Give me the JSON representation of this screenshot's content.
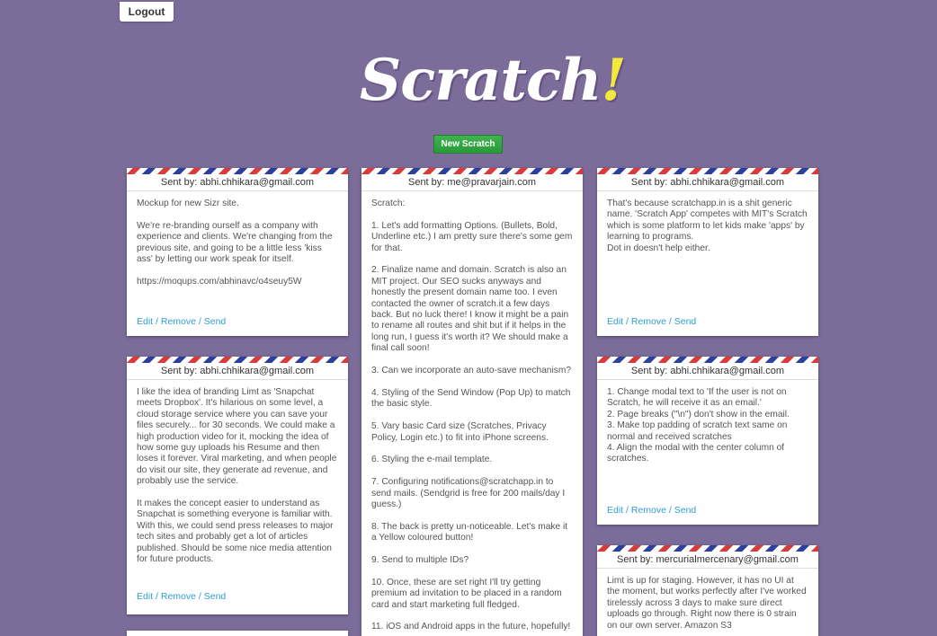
{
  "header": {
    "logout_label": "Logout",
    "logo_text": "Scratch",
    "logo_bang": "!",
    "new_button_label": "New Scratch"
  },
  "actions": {
    "edit": "Edit",
    "remove": "Remove",
    "send": "Send",
    "separator": " / "
  },
  "cards": [
    {
      "sender": "Sent by: abhi.chhikara@gmail.com",
      "body": "Mockup for new Sizr site.\n\nWe're re-branding ourself as a company with experience and clients. We're changing from the previous site, and going to be a little less 'kiss ass' by letting our work speak for itself.\n\nhttps://moqups.com/abhinavc/o4seuy5W"
    },
    {
      "sender": "Sent by: abhi.chhikara@gmail.com",
      "body": "I like the idea of branding Limt as 'Snapchat meets Dropbox'. It's hilarious on some level, a cloud storage service where you can save your files securely... for 30 seconds. We could make a high production video for it, mocking the idea of how some guy uploads his Resume and then loses it forever. Viral marketing, and when people do visit our site, they generate ad revenue, and probably use the service.\n\nIt makes the concept easier to understand as Snapchat is something everyone is familiar with. With this, we could send press releases to major tech sites and probably get a lot of articles published. Should be some nice media attention for future products."
    },
    {
      "sender": "Sent by: me@pravarjain.com",
      "body": "Scratch:\n\n1. Let's add formatting Options. (Bullets, Bold, Underline etc.) I am pretty sure there's some gem for that.\n\n2. Finalize name and domain. Scratch is also an MIT project. Our SEO sucks anyways and honestly the present domain name too. I even contacted the owner of scratch.it a few days back. But no luck there! I know it might be a pain to rename all routes and shit but if it helps in the long run, I guess it's worth it? We should make a final call soon!\n\n3. Can we incorporate an auto-save mechanism?\n\n4. Styling of the Send Window (Pop Up) to match the basic style.\n\n5. Vary basic Card size (Scratches, Privacy Policy, Login etc.) to fit into iPhone screens.\n\n6. Styling the e-mail template.\n\n7. Configuring notifications@scratchapp.in to send mails. (Sendgrid is free for 200 mails/day I guess.)\n\n8. The back is pretty un-noticeable. Let's make it a Yellow coloured button!\n\n9. Send to multiple IDs?\n\n10. Once, these are set right I'll try getting premium ad invitation to be placed in a random card and start marketing full fledged.\n\n11. iOS and Android apps in the future, hopefully!"
    },
    {
      "sender": "Sent by: abhi.chhikara@gmail.com",
      "body": "That's because scratchapp.in is a shit generic name. 'Scratch App' competes with MIT's Scratch which is some platform to let kids make 'apps' by learning to programs.\nDot in doesn't help either."
    },
    {
      "sender": "Sent by: abhi.chhikara@gmail.com",
      "body": "1. Change modal text to 'If the user is not on Scratch, he will receive it as an email.'\n2. Page breaks (\"\\n\") don't show in the email.\n3. Make top padding of scratch text same on normal and received scratches\n4. Align the modal with the center column of scratches."
    },
    {
      "sender": "Sent by: mercurialmercenary@gmail.com",
      "body": "Limt is up for staging. However, it has no UI at the moment, but works perfectly after I've worked tirelessly across 3 days to make sure direct uploads go through. Right now there is 0 strain on our own server. Amazon S3"
    }
  ]
}
